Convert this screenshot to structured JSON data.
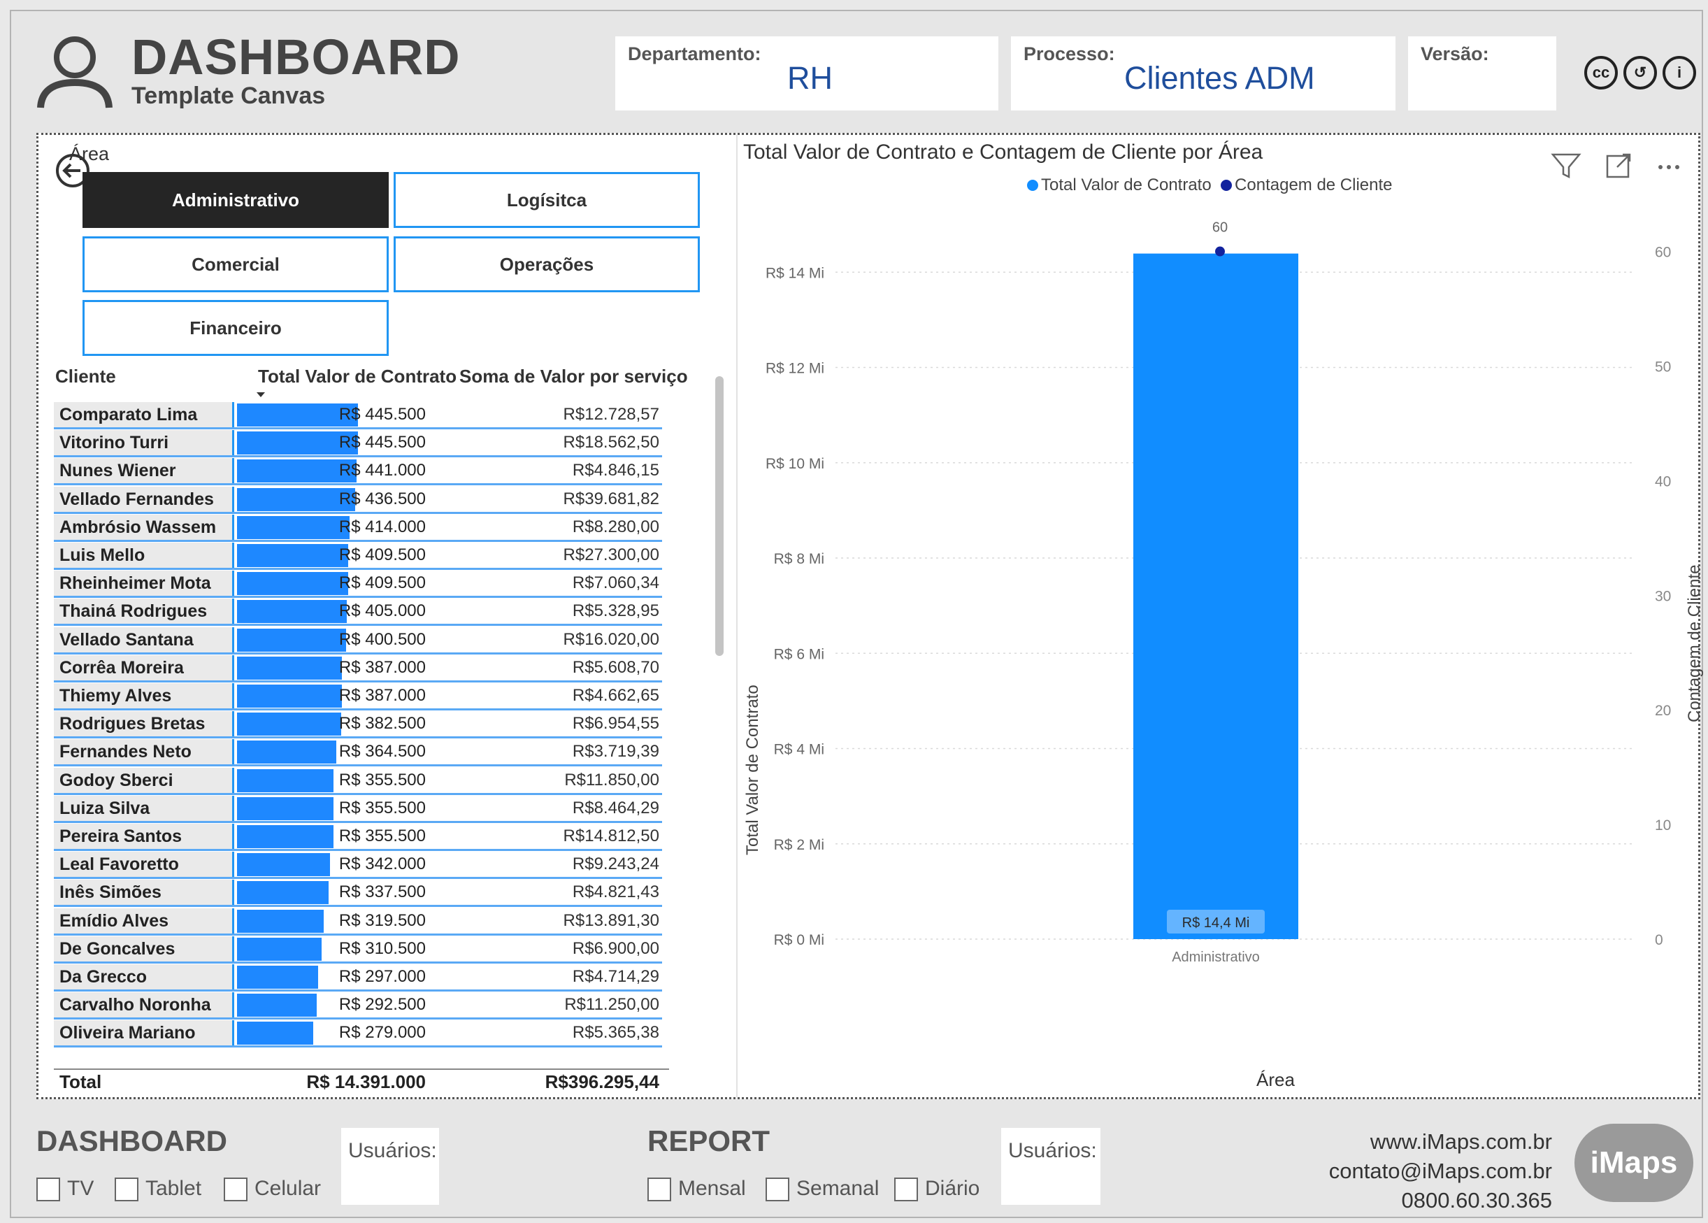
{
  "header": {
    "title": "DASHBOARD",
    "subtitle": "Template Canvas",
    "departamento_label": "Departamento:",
    "departamento_value": "RH",
    "processo_label": "Processo:",
    "processo_value": "Clientes ADM",
    "versao_label": "Versão:",
    "versao_value": ""
  },
  "slicer": {
    "label": "Área",
    "items": [
      {
        "label": "Administrativo",
        "selected": true
      },
      {
        "label": "Logísitca",
        "selected": false
      },
      {
        "label": "Comercial",
        "selected": false
      },
      {
        "label": "Operações",
        "selected": false
      },
      {
        "label": "Financeiro",
        "selected": false
      }
    ]
  },
  "table": {
    "columns": [
      "Cliente",
      "Total Valor de Contrato",
      "Soma de Valor por serviço"
    ],
    "rows": [
      {
        "cliente": "Comparato Lima",
        "valor": "R$ 445.500",
        "soma": "R$12.728,57",
        "fraction": 1.0
      },
      {
        "cliente": "Vitorino Turri",
        "valor": "R$ 445.500",
        "soma": "R$18.562,50",
        "fraction": 1.0
      },
      {
        "cliente": "Nunes Wiener",
        "valor": "R$ 441.000",
        "soma": "R$4.846,15",
        "fraction": 0.99
      },
      {
        "cliente": "Vellado Fernandes",
        "valor": "R$ 436.500",
        "soma": "R$39.681,82",
        "fraction": 0.98
      },
      {
        "cliente": "Ambrósio Wassem",
        "valor": "R$ 414.000",
        "soma": "R$8.280,00",
        "fraction": 0.93
      },
      {
        "cliente": "Luis Mello",
        "valor": "R$ 409.500",
        "soma": "R$27.300,00",
        "fraction": 0.92
      },
      {
        "cliente": "Rheinheimer Mota",
        "valor": "R$ 409.500",
        "soma": "R$7.060,34",
        "fraction": 0.92
      },
      {
        "cliente": "Thainá Rodrigues",
        "valor": "R$ 405.000",
        "soma": "R$5.328,95",
        "fraction": 0.91
      },
      {
        "cliente": "Vellado Santana",
        "valor": "R$ 400.500",
        "soma": "R$16.020,00",
        "fraction": 0.9
      },
      {
        "cliente": "Corrêa Moreira",
        "valor": "R$ 387.000",
        "soma": "R$5.608,70",
        "fraction": 0.87
      },
      {
        "cliente": "Thiemy Alves",
        "valor": "R$ 387.000",
        "soma": "R$4.662,65",
        "fraction": 0.87
      },
      {
        "cliente": "Rodrigues Bretas",
        "valor": "R$ 382.500",
        "soma": "R$6.954,55",
        "fraction": 0.86
      },
      {
        "cliente": "Fernandes Neto",
        "valor": "R$ 364.500",
        "soma": "R$3.719,39",
        "fraction": 0.82
      },
      {
        "cliente": "Godoy Sberci",
        "valor": "R$ 355.500",
        "soma": "R$11.850,00",
        "fraction": 0.8
      },
      {
        "cliente": "Luiza Silva",
        "valor": "R$ 355.500",
        "soma": "R$8.464,29",
        "fraction": 0.8
      },
      {
        "cliente": "Pereira Santos",
        "valor": "R$ 355.500",
        "soma": "R$14.812,50",
        "fraction": 0.8
      },
      {
        "cliente": "Leal Favoretto",
        "valor": "R$ 342.000",
        "soma": "R$9.243,24",
        "fraction": 0.77
      },
      {
        "cliente": "Inês Simões",
        "valor": "R$ 337.500",
        "soma": "R$4.821,43",
        "fraction": 0.76
      },
      {
        "cliente": "Emídio Alves",
        "valor": "R$ 319.500",
        "soma": "R$13.891,30",
        "fraction": 0.72
      },
      {
        "cliente": "De Goncalves",
        "valor": "R$ 310.500",
        "soma": "R$6.900,00",
        "fraction": 0.7
      },
      {
        "cliente": "Da Grecco",
        "valor": "R$ 297.000",
        "soma": "R$4.714,29",
        "fraction": 0.67
      },
      {
        "cliente": "Carvalho Noronha",
        "valor": "R$ 292.500",
        "soma": "R$11.250,00",
        "fraction": 0.66
      },
      {
        "cliente": "Oliveira Mariano",
        "valor": "R$ 279.000",
        "soma": "R$5.365,38",
        "fraction": 0.63
      }
    ],
    "total_label": "Total",
    "total_valor": "R$ 14.391.000",
    "total_soma": "R$396.295,44"
  },
  "chart_data": {
    "type": "bar",
    "title": "Total Valor de Contrato e Contagem de Cliente por Área",
    "categories": [
      "Administrativo"
    ],
    "series": [
      {
        "name": "Total Valor de Contrato",
        "values": [
          14391000
        ],
        "axis": "left",
        "kind": "bar"
      },
      {
        "name": "Contagem de Cliente",
        "values": [
          60
        ],
        "axis": "right",
        "kind": "line"
      }
    ],
    "bar_data_label": "R$ 14,4 Mi",
    "point_data_label": "60",
    "xlabel": "Área",
    "ylabel": "Total Valor de Contrato",
    "y2label": "Contagem de Cliente",
    "ylim": [
      0,
      16000000
    ],
    "y2lim": [
      0,
      66.5
    ],
    "yticks": [
      0,
      2000000,
      4000000,
      6000000,
      8000000,
      10000000,
      12000000,
      14000000
    ],
    "ytick_labels": [
      "R$ 0 Mi",
      "R$ 2 Mi",
      "R$ 4 Mi",
      "R$ 6 Mi",
      "R$ 8 Mi",
      "R$ 10 Mi",
      "R$ 12 Mi",
      "R$ 14 Mi"
    ],
    "y2ticks": [
      0,
      10,
      20,
      30,
      40,
      50,
      60
    ],
    "grid": true,
    "legend": "top-center",
    "colors": {
      "bar": "#118dff",
      "line": "#12239e"
    }
  },
  "footer": {
    "dashboard_title": "DASHBOARD",
    "dashboard_users_label": "Usuários:",
    "tv_label": "TV",
    "tablet_label": "Tablet",
    "celular_label": "Celular",
    "report_title": "REPORT",
    "report_users_label": "Usuários:",
    "mensal_label": "Mensal",
    "semanal_label": "Semanal",
    "diario_label": "Diário",
    "website": "www.iMaps.com.br",
    "email": "contato@iMaps.com.br",
    "phone": "0800.60.30.365",
    "logo_text": "iMaps"
  },
  "icons": {
    "license": [
      "cc-icon",
      "share-alike-icon",
      "attribution-icon"
    ],
    "chart_tools": [
      "filter-icon",
      "focus-mode-icon",
      "more-options-icon"
    ]
  }
}
